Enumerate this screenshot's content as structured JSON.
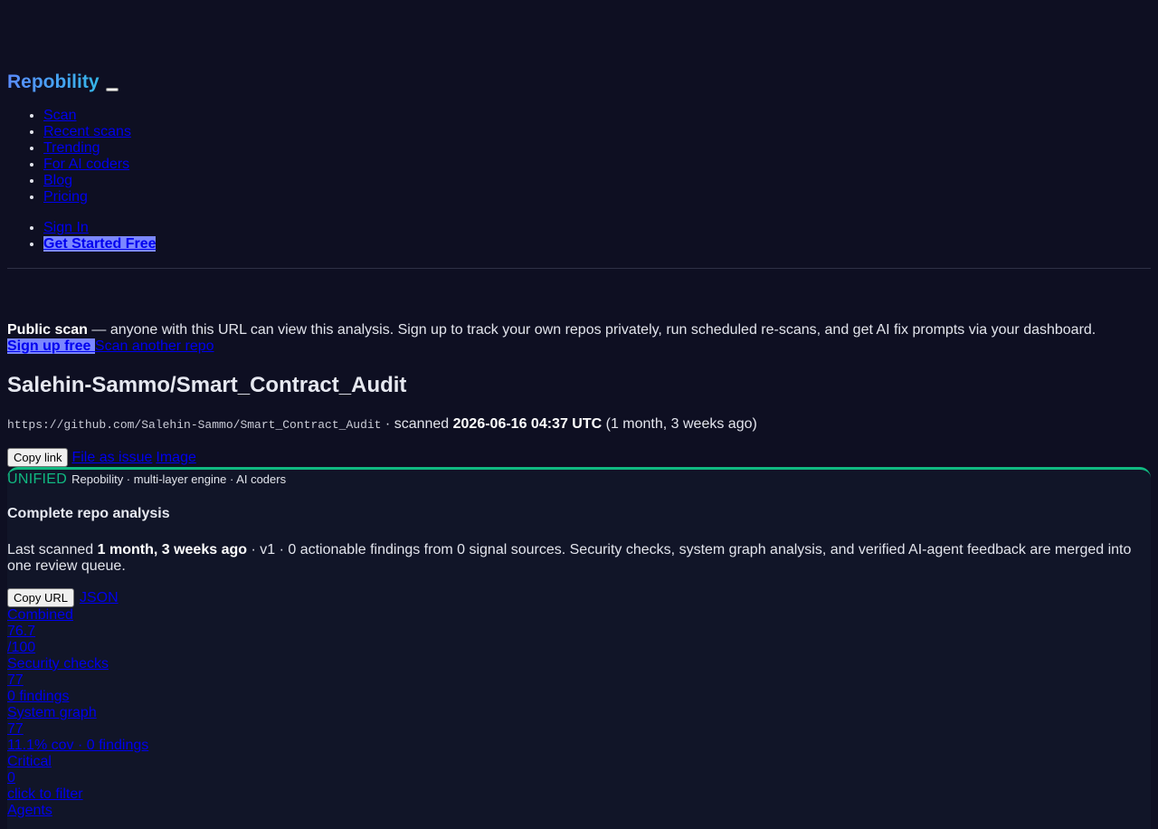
{
  "header": {
    "brand": "Repobility",
    "nav": [
      "Scan",
      "Recent scans",
      "Trending",
      "For AI coders",
      "Blog",
      "Pricing"
    ],
    "auth": {
      "sign_in": "Sign In",
      "get_started": "Get Started Free"
    }
  },
  "notice": {
    "bold": "Public scan",
    "text": " — anyone with this URL can view this analysis. Sign up to track your own repos privately, run scheduled re-scans, and get AI fix prompts via your dashboard.",
    "signup": "Sign up free ",
    "scan_another": "Scan another repo"
  },
  "repo": {
    "title": "Salehin-Sammo/Smart_Contract_Audit",
    "url": "https://github.com/Salehin-Sammo/Smart_Contract_Audit",
    "scanned_prefix": " · scanned ",
    "scanned_at": "2026-06-16 04:37 UTC",
    "scanned_ago": " (1 month, 3 weeks ago)",
    "copy_link": "Copy link",
    "file_issue": "File as issue",
    "image": "Image"
  },
  "panel": {
    "badge": "UNIFIED",
    "engine": "Repobility · multi-layer engine · AI coders",
    "title": "Complete repo analysis",
    "desc_prefix": "Last scanned ",
    "desc_when": "1 month, 3 weeks ago",
    "desc_rest": " · v1 · 0 actionable findings from 0 signal sources. Security checks, system graph analysis, and verified AI-agent feedback are merged into one review queue.",
    "copy_url": "Copy URL",
    "json": "JSON"
  },
  "stats": [
    {
      "label": "Combined",
      "value": "76.7",
      "sub": "/100"
    },
    {
      "label": "Security checks",
      "value": "77",
      "sub": "0 findings"
    },
    {
      "label": "System graph",
      "value": "77",
      "sub": "11.1% cov · 0 findings"
    },
    {
      "label": "Critical",
      "value": "0",
      "sub": "click to filter"
    },
    {
      "label": "Agents"
    }
  ],
  "colors": {
    "background": "#0e0f22",
    "accent_green": "#10b981",
    "cta": "#7b87ff"
  }
}
